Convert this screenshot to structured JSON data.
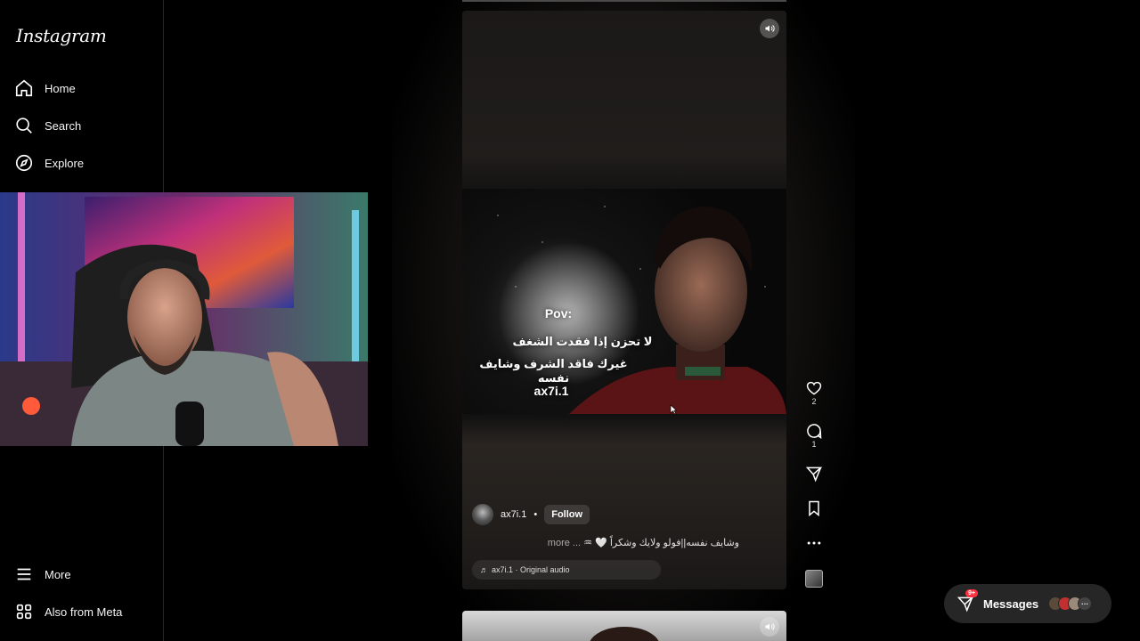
{
  "app": {
    "logo": "Instagram"
  },
  "sidebar": {
    "items": [
      {
        "label": "Home",
        "icon": "home-icon"
      },
      {
        "label": "Search",
        "icon": "search-icon"
      },
      {
        "label": "Explore",
        "icon": "compass-icon"
      }
    ],
    "bottom_items": [
      {
        "label": "More",
        "icon": "menu-icon"
      },
      {
        "label": "Also from Meta",
        "icon": "grid-icon"
      }
    ]
  },
  "reel": {
    "overlay": {
      "pov": "Pov:",
      "line1": "لا تحزن إذا فقدت الشغف",
      "line2": "غيرك فاقد الشرف وشايف نفسه",
      "watermark": "ax7i.1"
    },
    "author": "ax7i.1",
    "separator": "•",
    "follow_label": "Follow",
    "caption": "وشايف نفسه||فولو ولايك وشكراً 🤍 ♒",
    "caption_more": "more ...",
    "audio": "ax7i.1 · Original audio",
    "likes": "2",
    "comments": "1"
  },
  "messages": {
    "label": "Messages",
    "badge": "9+"
  },
  "colors": {
    "background": "#000000",
    "badge": "#ff3040",
    "panel": "#262626"
  }
}
